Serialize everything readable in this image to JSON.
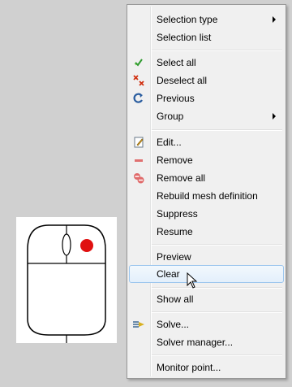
{
  "context_menu": {
    "items": [
      {
        "label": "Selection type",
        "icon": "",
        "submenu": true
      },
      {
        "label": "Selection list",
        "icon": "",
        "submenu": false
      },
      {
        "label": "Select all",
        "icon": "select-all-icon",
        "submenu": false
      },
      {
        "label": "Deselect all",
        "icon": "deselect-all-icon",
        "submenu": false
      },
      {
        "label": "Previous",
        "icon": "previous-icon",
        "submenu": false
      },
      {
        "label": "Group",
        "icon": "",
        "submenu": true
      },
      {
        "label": "Edit...",
        "icon": "edit-icon",
        "submenu": false
      },
      {
        "label": "Remove",
        "icon": "remove-icon",
        "submenu": false
      },
      {
        "label": "Remove all",
        "icon": "remove-all-icon",
        "submenu": false
      },
      {
        "label": "Rebuild mesh definition",
        "icon": "",
        "submenu": false
      },
      {
        "label": "Suppress",
        "icon": "",
        "submenu": false
      },
      {
        "label": "Resume",
        "icon": "",
        "submenu": false
      },
      {
        "label": "Preview",
        "icon": "",
        "submenu": false
      },
      {
        "label": "Clear",
        "icon": "",
        "submenu": false,
        "highlighted": true
      },
      {
        "label": "Show all",
        "icon": "",
        "submenu": false
      },
      {
        "label": "Solve...",
        "icon": "solve-icon",
        "submenu": false
      },
      {
        "label": "Solver manager...",
        "icon": "",
        "submenu": false
      },
      {
        "label": "Monitor point...",
        "icon": "",
        "submenu": false
      }
    ]
  },
  "colors": {
    "menu_background": "#f0f0f0",
    "highlight_border": "#9cc6ee",
    "mouse_button_indicator": "#e01010",
    "desktop_background": "#d0d0d0"
  }
}
